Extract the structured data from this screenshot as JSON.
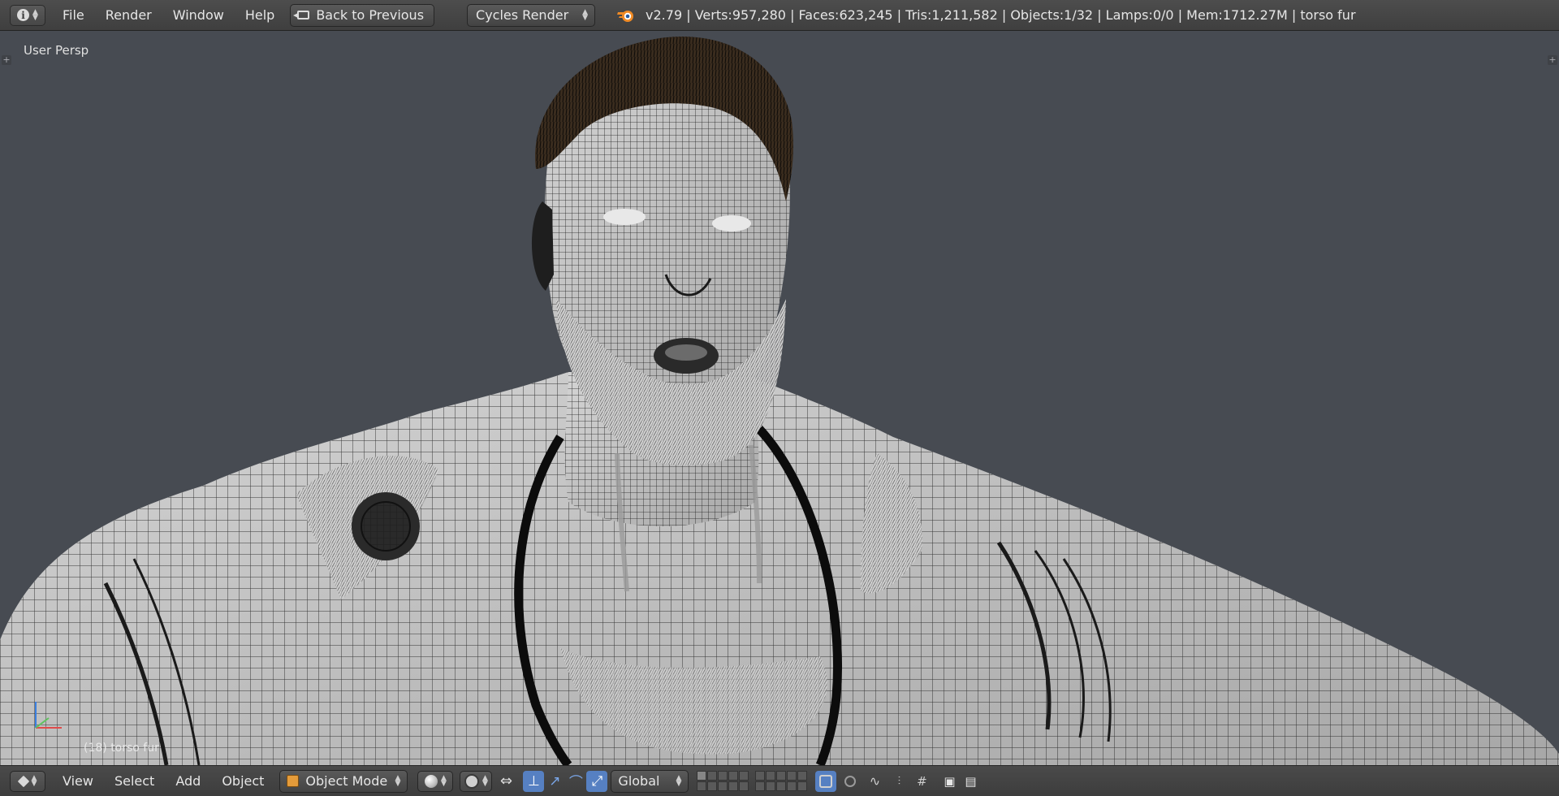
{
  "window": {
    "editor_type_icon": "info-icon"
  },
  "topbar": {
    "menus": [
      "File",
      "Render",
      "Window",
      "Help"
    ],
    "back_button": "Back to Previous",
    "render_engine": "Cycles Render",
    "stats": "v2.79 | Verts:957,280 | Faces:623,245 | Tris:1,211,582 | Objects:1/32 | Lamps:0/0 | Mem:1712.27M | torso fur"
  },
  "viewport": {
    "view_label": "User Persp",
    "object_label": "(18) torso fur"
  },
  "bottombar": {
    "menus": [
      "View",
      "Select",
      "Add",
      "Object"
    ],
    "mode": "Object Mode",
    "transform_orientation": "Global"
  },
  "colors": {
    "viewport_bg": "#474b52",
    "header_bg": "#434343",
    "active_blue": "#5680c2",
    "object_orange": "#e49b3a"
  }
}
